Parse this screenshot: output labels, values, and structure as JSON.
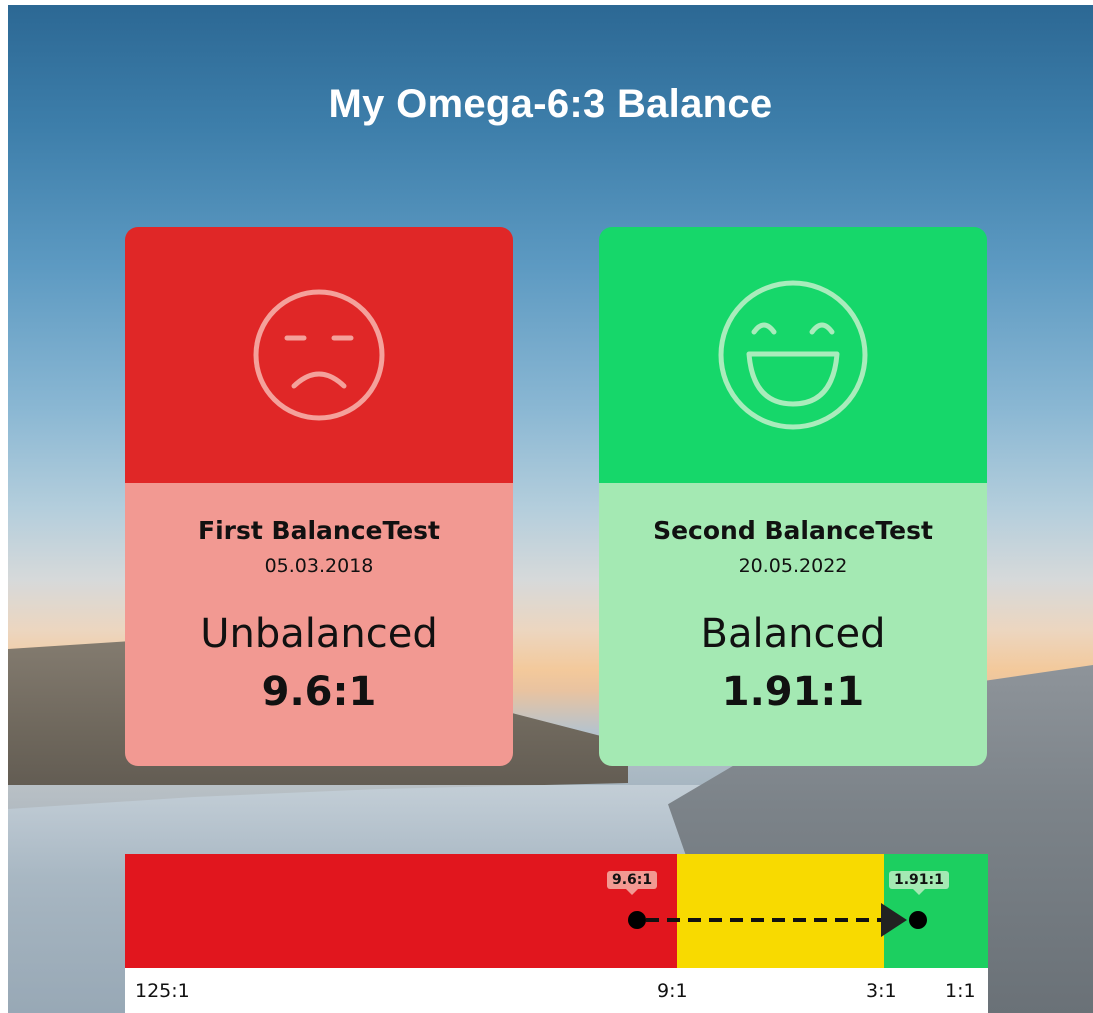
{
  "title": "My Omega-6:3 Balance",
  "cards": [
    {
      "heading": "First BalanceTest",
      "date": "05.03.2018",
      "status": "Unbalanced",
      "ratio": "9.6:1",
      "face_icon": "sad-face-icon",
      "top_color": "#e02727",
      "bottom_color": "#f29992"
    },
    {
      "heading": "Second BalanceTest",
      "date": "20.05.2022",
      "status": "Balanced",
      "ratio": "1.91:1",
      "face_icon": "laughing-face-icon",
      "top_color": "#16d76a",
      "bottom_color": "#a4e9b3"
    }
  ],
  "scale": {
    "segments": [
      {
        "color": "#e1161e",
        "from": "125:1",
        "to": "9:1"
      },
      {
        "color": "#f8da00",
        "from": "9:1",
        "to": "3:1"
      },
      {
        "color": "#1ccf60",
        "from": "3:1",
        "to": "1:1"
      }
    ],
    "ticks": [
      "125:1",
      "9:1",
      "3:1",
      "1:1"
    ],
    "markers": [
      {
        "label": "9.6:1",
        "value": 9.6
      },
      {
        "label": "1.91:1",
        "value": 1.91
      }
    ]
  }
}
